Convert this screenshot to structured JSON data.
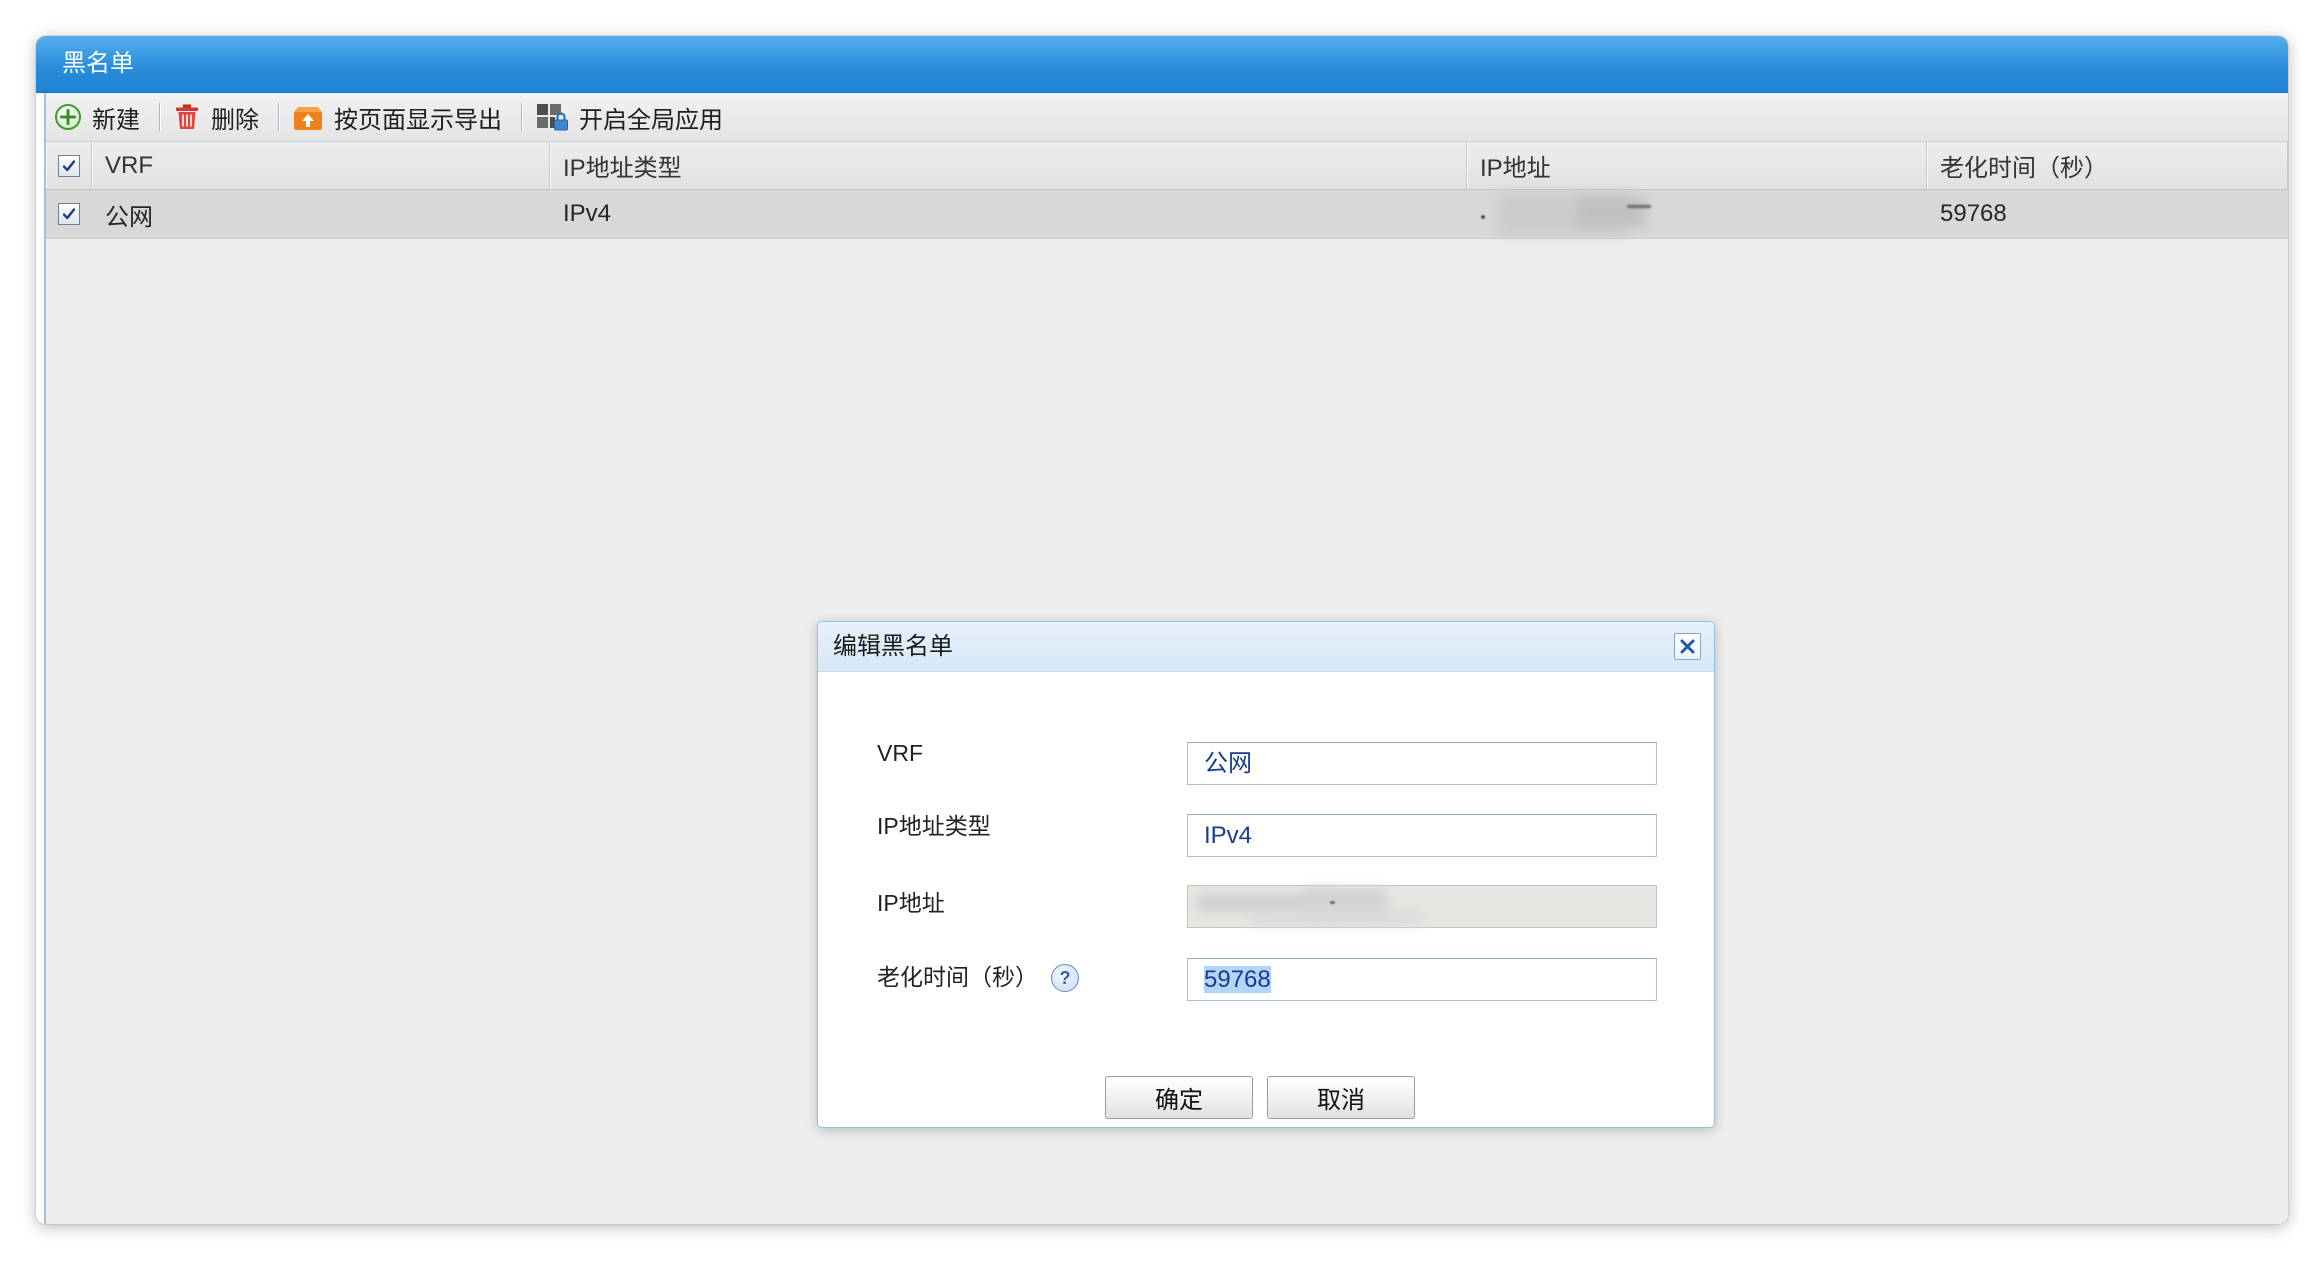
{
  "window": {
    "title": "黑名单"
  },
  "toolbar": {
    "items": [
      {
        "label": "新建",
        "icon": "add-icon"
      },
      {
        "label": "删除",
        "icon": "delete-icon"
      },
      {
        "label": "按页面显示导出",
        "icon": "export-icon"
      },
      {
        "label": "开启全局应用",
        "icon": "global-apply-icon"
      }
    ]
  },
  "table": {
    "header_checked": true,
    "columns": [
      "VRF",
      "IP地址类型",
      "IP地址",
      "老化时间（秒）"
    ],
    "rows": [
      {
        "checked": true,
        "selected": true,
        "vrf": "公网",
        "ip_type": "IPv4",
        "aging_time": "59768"
      }
    ]
  },
  "dialog": {
    "title": "编辑黑名单",
    "close_icon": "close-icon",
    "fields": [
      {
        "label": "VRF",
        "value": "公网"
      },
      {
        "label": "IP地址类型",
        "value": "IPv4"
      },
      {
        "label": "IP地址",
        "disabled": true
      },
      {
        "label": "老化时间（秒）",
        "value": "59768",
        "text_selected": true,
        "help_icon": "help-icon",
        "help_glyph": "?"
      }
    ],
    "buttons": {
      "ok": "确定",
      "cancel": "取消"
    }
  },
  "colors": {
    "title_bar": "#2a8edb",
    "dialog_header": "#d7e8f6",
    "selected_row": "#d8d8d8",
    "input_text": "#173d8f",
    "text_selection": "#b4d4f8",
    "add_icon": "#3f9a32",
    "delete_icon": "#d7362b",
    "export_icon": "#f0821e"
  }
}
